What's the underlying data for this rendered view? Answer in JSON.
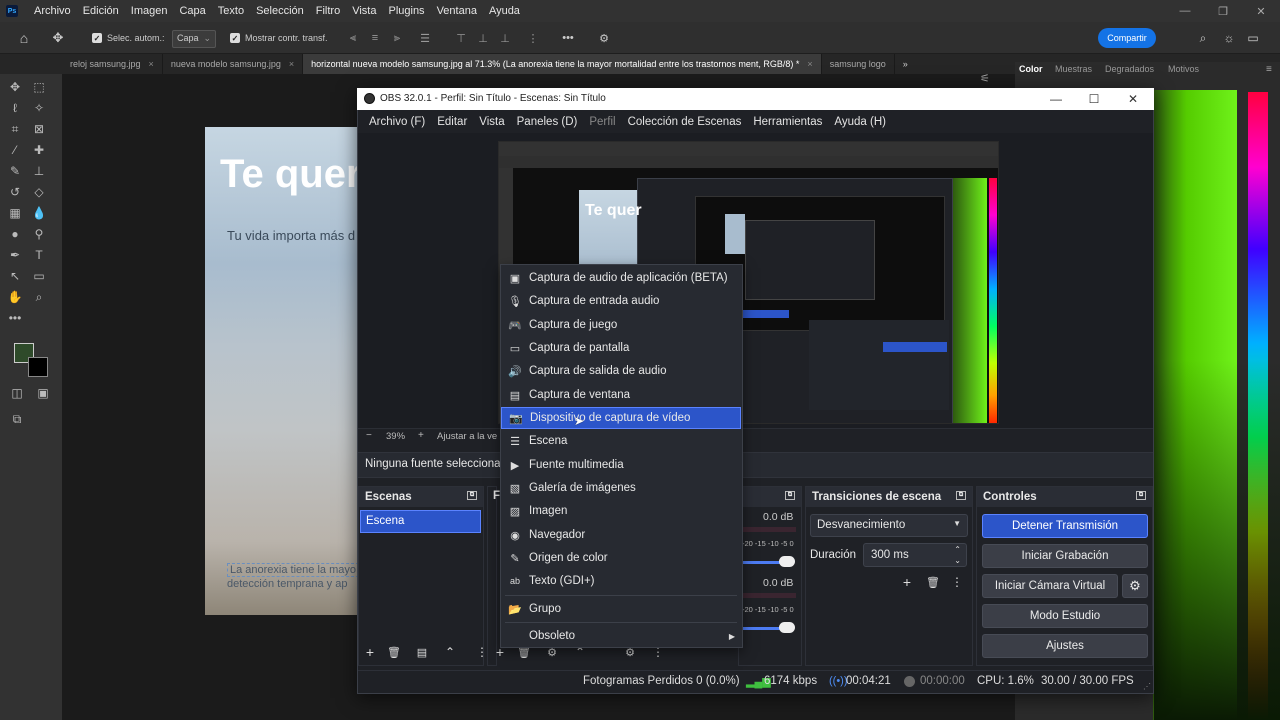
{
  "ps": {
    "menu": [
      "Archivo",
      "Edición",
      "Imagen",
      "Capa",
      "Texto",
      "Selección",
      "Filtro",
      "Vista",
      "Plugins",
      "Ventana",
      "Ayuda"
    ],
    "options": {
      "auto_select": "Selec. autom.:",
      "layer_select": "Capa",
      "show_transform": "Mostrar contr. transf.",
      "share": "Compartir"
    },
    "tabs": [
      {
        "label": "reloj samsung.jpg"
      },
      {
        "label": "nueva modelo samsung.jpg"
      },
      {
        "label": "horizontal nueva modelo samsung.jpg al 71.3% (La anorexia tiene la mayor mortalidad entre los trastornos ment, RGB/8) *"
      },
      {
        "label": "samsung logo"
      }
    ],
    "panel_tabs": [
      "Color",
      "Muestras",
      "Degradados",
      "Motivos"
    ],
    "doc": {
      "title": "Te quer",
      "subtitle": "Tu vida importa más d",
      "line1": "La anorexia tiene la mayo",
      "line2": "detección temprana y ap"
    }
  },
  "obs": {
    "title": "OBS 32.0.1 - Perfil: Sin Título - Escenas: Sin Título",
    "menu": [
      "Archivo (F)",
      "Editar",
      "Vista",
      "Paneles (D)",
      "Perfil",
      "Colección de Escenas",
      "Herramientas",
      "Ayuda (H)"
    ],
    "zoom": "39%",
    "fit": "Ajustar a la ve",
    "no_source": "Ninguna fuente selecciona",
    "scenes_title": "Escenas",
    "scene_item": "Escena",
    "sources_title": "F",
    "mixer": {
      "db1": "0.0 dB",
      "db2": "0.0 dB",
      "scale": "-20 -15 -10 -5 0"
    },
    "transitions": {
      "title": "Transiciones de escena",
      "selected": "Desvanecimiento",
      "duration_label": "Duración",
      "duration_value": "300 ms"
    },
    "controls": {
      "title": "Controles",
      "stop_stream": "Detener Transmisión",
      "start_rec": "Iniciar Grabación",
      "start_vcam": "Iniciar Cámara Virtual",
      "studio": "Modo Estudio",
      "settings": "Ajustes"
    },
    "status": {
      "dropped": "Fotogramas Perdidos 0 (0.0%)",
      "bitrate": "6174 kbps",
      "stream_time": "00:04:21",
      "rec_time": "00:00:00",
      "cpu": "CPU: 1.6%",
      "fps": "30.00 / 30.00 FPS"
    },
    "context_menu": [
      {
        "label": "Captura de audio de aplicación (BETA)",
        "icon": "app-audio-icon"
      },
      {
        "label": "Captura de entrada audio",
        "icon": "microphone-icon"
      },
      {
        "label": "Captura de juego",
        "icon": "gamepad-icon"
      },
      {
        "label": "Captura de pantalla",
        "icon": "monitor-icon"
      },
      {
        "label": "Captura de salida de audio",
        "icon": "speaker-icon"
      },
      {
        "label": "Captura de ventana",
        "icon": "window-icon"
      },
      {
        "label": "Dispositivo de captura de vídeo",
        "icon": "camera-icon"
      },
      {
        "label": "Escena",
        "icon": "list-icon"
      },
      {
        "label": "Fuente multimedia",
        "icon": "play-icon"
      },
      {
        "label": "Galería de imágenes",
        "icon": "gallery-icon"
      },
      {
        "label": "Imagen",
        "icon": "image-icon"
      },
      {
        "label": "Navegador",
        "icon": "globe-icon"
      },
      {
        "label": "Origen de color",
        "icon": "brush-icon"
      },
      {
        "label": "Texto (GDI+)",
        "icon": "text-icon"
      },
      {
        "label": "Grupo",
        "icon": "folder-icon"
      },
      {
        "label": "Obsoleto",
        "icon": "submenu-arrow-icon"
      }
    ]
  },
  "colors": {
    "obs_accent": "#2c55c9",
    "ps_share": "#1473e6"
  }
}
